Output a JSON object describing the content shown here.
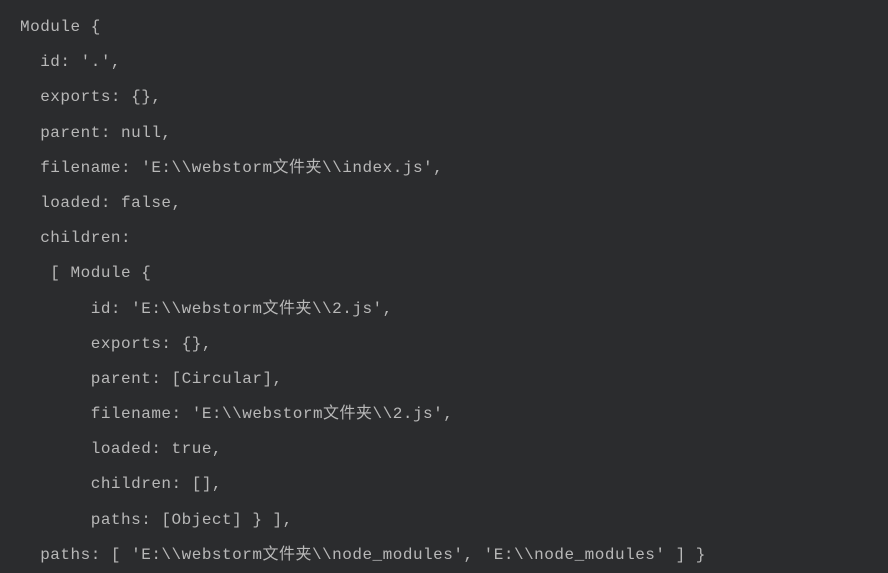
{
  "code": {
    "l1": "Module {",
    "l2": "  id: '.',",
    "l3": "  exports: {},",
    "l4": "  parent: null,",
    "l5": "  filename: 'E:\\\\webstorm文件夹\\\\index.js',",
    "l6": "  loaded: false,",
    "l7": "  children:",
    "l8": "   [ Module {",
    "l9": "       id: 'E:\\\\webstorm文件夹\\\\2.js',",
    "l10": "       exports: {},",
    "l11": "       parent: [Circular],",
    "l12": "       filename: 'E:\\\\webstorm文件夹\\\\2.js',",
    "l13": "       loaded: true,",
    "l14": "       children: [],",
    "l15": "       paths: [Object] } ],",
    "l16": "  paths: [ 'E:\\\\webstorm文件夹\\\\node_modules', 'E:\\\\node_modules' ] }"
  }
}
